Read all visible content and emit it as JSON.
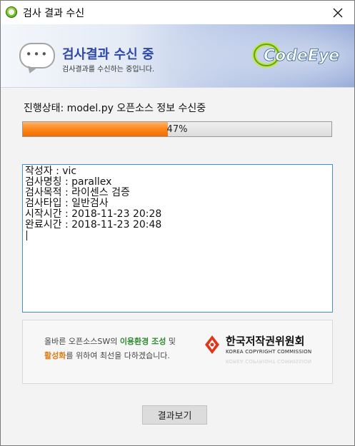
{
  "window": {
    "title": "검사 결과 수신"
  },
  "banner": {
    "title": "검사결과 수신 중",
    "subtitle": "검사결과를 수신하는 중입니다.",
    "logo_text": "CodeEye"
  },
  "status": {
    "text": "진행상태: model.py 오픈소스 정보 수신중"
  },
  "progress": {
    "value": 0.47,
    "label": "47%",
    "color": "#ff8a1e"
  },
  "log": {
    "lines": [
      "작성자 : vic",
      "검사명칭 : parallex",
      "검사목적 : 라이센스 검증",
      "검사타입 : 일반검사",
      "시작시간 : 2018-11-23 20:28",
      "완료시간 : 2018-11-23 20:48"
    ]
  },
  "notice": {
    "line1_pre": "올바른 오픈소스SW의 ",
    "line1_green": "이용환경 조성",
    "line1_post": " 및",
    "line2_orange": "활성화",
    "line2_post": "를 위하여 최선을 다하겠습니다.",
    "org_kor": "한국저작권위원회",
    "org_eng": "KOREA COPYRIGHT COMMISSION"
  },
  "buttons": {
    "result_label": "결과보기"
  },
  "colors": {
    "accent": "#2c47a8",
    "border_focus": "#3f8fde"
  }
}
